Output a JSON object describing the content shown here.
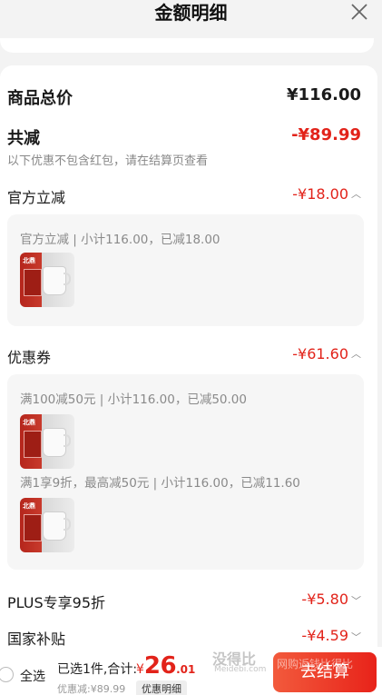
{
  "header": {
    "title": "金额明细",
    "close_icon": "close-icon"
  },
  "summary_rows": {
    "total": {
      "label": "商品总价",
      "value": "¥116.00"
    },
    "reduction": {
      "label": "共减",
      "value": "-¥89.99",
      "note": "以下优惠不包含红包，请在结算页查看"
    }
  },
  "sections": [
    {
      "label": "官方立减",
      "value": "-¥18.00",
      "chevron": "^",
      "lines": [
        "官方立减 | 小计116.00，已减18.00"
      ]
    },
    {
      "label": "优惠券",
      "value": "-¥61.60",
      "chevron": "^",
      "lines": [
        "满100减50元 | 小计116.00，已减50.00",
        "满1享9折，最高减50元 | 小计116.00，已减11.60"
      ]
    },
    {
      "label": "PLUS专享95折",
      "value": "-¥5.80",
      "chevron": "⌄"
    },
    {
      "label": "国家补贴",
      "value": "-¥4.59",
      "chevron": "⌄"
    }
  ],
  "product_thumb": {
    "tag": "北鼎"
  },
  "footer": {
    "select_all": "全选",
    "selected_summary": "已选1件,合计:",
    "currency": "¥",
    "amount_int": "26",
    "amount_dec": ".01",
    "discount_text": "优惠减:¥89.99",
    "detail_link": "优惠明细",
    "checkout": "去结算"
  },
  "watermark": {
    "main": "没得比",
    "sub": "Meidebi.com",
    "overlay": "网购返钱比得比"
  },
  "colors": {
    "accent_red": "#e2231a",
    "checkout_gradient_start": "#f25a3c",
    "checkout_gradient_end": "#e8231a"
  }
}
